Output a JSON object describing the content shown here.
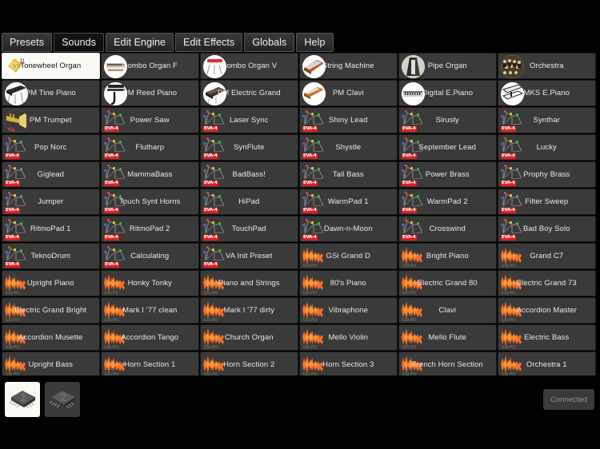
{
  "tabs": [
    {
      "label": "Presets",
      "active": false
    },
    {
      "label": "Sounds",
      "active": true
    },
    {
      "label": "Edit Engine",
      "active": false
    },
    {
      "label": "Edit Effects",
      "active": false
    },
    {
      "label": "Globals",
      "active": false
    },
    {
      "label": "Help",
      "active": false
    }
  ],
  "icon_badges": {
    "synth": "EVA-4",
    "piano": "GSi-PO"
  },
  "colors": {
    "background": "#000000",
    "cell": "#3a3a3a",
    "cell_selected": "#fbfbf6",
    "label": "#e8e8e8",
    "badge_red": "#e02020",
    "wave_orange": "#f47b20",
    "connected_text": "#8e8e8e"
  },
  "presets": [
    [
      {
        "name": "Tonewheel Organ",
        "icon": "organ-photo",
        "selected": true
      },
      {
        "name": "Combo Organ F",
        "icon": "combo-organ-photo",
        "selected": false
      },
      {
        "name": "Combo Organ V",
        "icon": "combo-organ-v-photo",
        "selected": false
      },
      {
        "name": "String Machine",
        "icon": "string-machine-photo",
        "selected": false
      },
      {
        "name": "Pipe Organ",
        "icon": "pipe-organ-photo",
        "selected": false
      },
      {
        "name": "Orchestra",
        "icon": "orchestra-photo",
        "selected": false
      }
    ],
    [
      {
        "name": "PM Tine Piano",
        "icon": "tine-piano-photo",
        "selected": false
      },
      {
        "name": "PM Reed Piano",
        "icon": "reed-piano-photo",
        "selected": false
      },
      {
        "name": "PM Electric Grand",
        "icon": "electric-grand-photo",
        "selected": false
      },
      {
        "name": "PM Clavi",
        "icon": "clavi-photo",
        "selected": false
      },
      {
        "name": "Digital E.Piano",
        "icon": "digital-piano-photo",
        "selected": false
      },
      {
        "name": "MKS E.Piano",
        "icon": "mks-piano-photo",
        "selected": false
      }
    ],
    [
      {
        "name": "PM Trumpet",
        "icon": "trumpet-photo",
        "selected": false
      },
      {
        "name": "Power Saw",
        "icon": "synth-eva",
        "selected": false
      },
      {
        "name": "Laser Sync",
        "icon": "synth-eva",
        "selected": false
      },
      {
        "name": "Shiny Lead",
        "icon": "synth-eva",
        "selected": false
      },
      {
        "name": "Sirusly",
        "icon": "synth-eva",
        "selected": false
      },
      {
        "name": "Synthar",
        "icon": "synth-eva",
        "selected": false
      }
    ],
    [
      {
        "name": "Pop Norc",
        "icon": "synth-eva",
        "selected": false
      },
      {
        "name": "Flutharp",
        "icon": "synth-eva",
        "selected": false
      },
      {
        "name": "SynFlute",
        "icon": "synth-eva",
        "selected": false
      },
      {
        "name": "Shystle",
        "icon": "synth-eva",
        "selected": false
      },
      {
        "name": "September Lead",
        "icon": "synth-eva",
        "selected": false
      },
      {
        "name": "Lucky",
        "icon": "synth-eva",
        "selected": false
      }
    ],
    [
      {
        "name": "Giglead",
        "icon": "synth-eva",
        "selected": false
      },
      {
        "name": "MammaBass",
        "icon": "synth-eva",
        "selected": false
      },
      {
        "name": "BadBass!",
        "icon": "synth-eva",
        "selected": false
      },
      {
        "name": "Tall Bass",
        "icon": "synth-eva",
        "selected": false
      },
      {
        "name": "Power Brass",
        "icon": "synth-eva",
        "selected": false
      },
      {
        "name": "Prophy Brass",
        "icon": "synth-eva",
        "selected": false
      }
    ],
    [
      {
        "name": "Jumper",
        "icon": "synth-eva",
        "selected": false
      },
      {
        "name": "Touch Synt Horns",
        "icon": "synth-eva",
        "selected": false
      },
      {
        "name": "HiPad",
        "icon": "synth-eva",
        "selected": false
      },
      {
        "name": "WarmPad 1",
        "icon": "synth-eva",
        "selected": false
      },
      {
        "name": "WarmPad 2",
        "icon": "synth-eva",
        "selected": false
      },
      {
        "name": "Filter Sweep",
        "icon": "synth-eva",
        "selected": false
      }
    ],
    [
      {
        "name": "RitmoPad 1",
        "icon": "synth-eva",
        "selected": false
      },
      {
        "name": "RitmoPad 2",
        "icon": "synth-eva",
        "selected": false
      },
      {
        "name": "TouchPad",
        "icon": "synth-eva",
        "selected": false
      },
      {
        "name": "Dawn-n-Moon",
        "icon": "synth-eva",
        "selected": false
      },
      {
        "name": "Crosswind",
        "icon": "synth-eva",
        "selected": false
      },
      {
        "name": "Bad Boy Solo",
        "icon": "synth-eva",
        "selected": false
      }
    ],
    [
      {
        "name": "TeknoDrum",
        "icon": "synth-eva",
        "selected": false
      },
      {
        "name": "Calculating",
        "icon": "synth-eva",
        "selected": false
      },
      {
        "name": "VA Init Preset",
        "icon": "synth-eva",
        "selected": false
      },
      {
        "name": "GSi Grand D",
        "icon": "piano-wave",
        "selected": false
      },
      {
        "name": "Bright Piano",
        "icon": "piano-wave",
        "selected": false
      },
      {
        "name": "Grand C7",
        "icon": "piano-wave",
        "selected": false
      }
    ],
    [
      {
        "name": "Upright Piano",
        "icon": "piano-wave",
        "selected": false
      },
      {
        "name": "Honky Tonky",
        "icon": "piano-wave",
        "selected": false
      },
      {
        "name": "Piano and Strings",
        "icon": "piano-wave",
        "selected": false
      },
      {
        "name": "80's Piano",
        "icon": "piano-wave",
        "selected": false
      },
      {
        "name": "Electric Grand 80",
        "icon": "piano-wave",
        "selected": false
      },
      {
        "name": "Electric Grand 73",
        "icon": "piano-wave",
        "selected": false
      }
    ],
    [
      {
        "name": "Electric Grand Bright",
        "icon": "piano-wave",
        "selected": false
      },
      {
        "name": "Mark I '77 clean",
        "icon": "piano-wave",
        "selected": false
      },
      {
        "name": "Mark I '77 dirty",
        "icon": "piano-wave",
        "selected": false
      },
      {
        "name": "Vibraphone",
        "icon": "piano-wave",
        "selected": false
      },
      {
        "name": "Clavi",
        "icon": "piano-wave",
        "selected": false
      },
      {
        "name": "Accordion Master",
        "icon": "piano-wave",
        "selected": false
      }
    ],
    [
      {
        "name": "Accordion Musette",
        "icon": "piano-wave",
        "selected": false
      },
      {
        "name": "Accordion Tango",
        "icon": "piano-wave",
        "selected": false
      },
      {
        "name": "Church Organ",
        "icon": "piano-wave",
        "selected": false
      },
      {
        "name": "Mello Violin",
        "icon": "piano-wave",
        "selected": false
      },
      {
        "name": "Mello Flute",
        "icon": "piano-wave",
        "selected": false
      },
      {
        "name": "Electric Bass",
        "icon": "piano-wave",
        "selected": false
      }
    ],
    [
      {
        "name": "Upright Bass",
        "icon": "piano-wave",
        "selected": false
      },
      {
        "name": "Horn Section 1",
        "icon": "piano-wave",
        "selected": false
      },
      {
        "name": "Horn Section 2",
        "icon": "piano-wave",
        "selected": false
      },
      {
        "name": "Horn Section 3",
        "icon": "piano-wave",
        "selected": false
      },
      {
        "name": "French Horn Section",
        "icon": "piano-wave",
        "selected": false
      },
      {
        "name": "Orchestra 1",
        "icon": "piano-wave",
        "selected": false
      }
    ]
  ],
  "bottom": {
    "slots": [
      {
        "label": "1",
        "selected": true
      },
      {
        "label": "2",
        "selected": false
      }
    ],
    "status": "Connected"
  }
}
